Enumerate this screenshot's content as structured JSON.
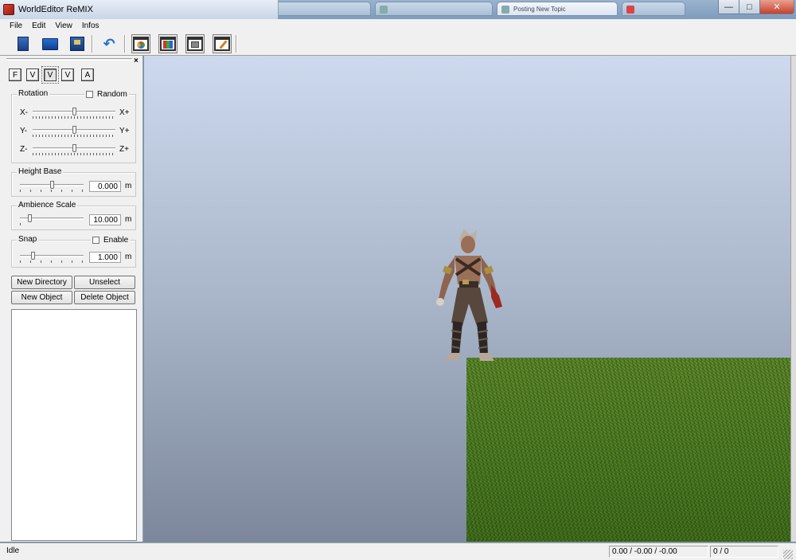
{
  "window": {
    "title": "WorldEditor ReMIX",
    "background_tabs": [
      {
        "label": "",
        "active": false
      },
      {
        "label": "",
        "active": false
      },
      {
        "label": "",
        "active": false
      },
      {
        "label": "",
        "active": false
      },
      {
        "label": "Posting New Topic",
        "active": true
      },
      {
        "label": "",
        "active": false
      }
    ]
  },
  "menu": {
    "items": [
      "File",
      "Edit",
      "View",
      "Infos"
    ]
  },
  "toolbar": {
    "buttons": [
      "new-document-icon",
      "open-folder-icon",
      "save-icon",
      "undo-icon",
      "world-window-icon",
      "palette-window-icon",
      "texture-window-icon",
      "paint-window-icon"
    ]
  },
  "panel": {
    "modes": [
      {
        "label": "F",
        "selected": false
      },
      {
        "label": "V",
        "selected": false
      },
      {
        "label": "V",
        "selected": true
      },
      {
        "label": "V",
        "selected": false
      },
      {
        "label": "A",
        "selected": false
      }
    ],
    "rotation": {
      "title": "Rotation",
      "random_label": "Random",
      "random_checked": false,
      "axes": [
        {
          "min": "X-",
          "max": "X+",
          "position": 0.5
        },
        {
          "min": "Y-",
          "max": "Y+",
          "position": 0.5
        },
        {
          "min": "Z-",
          "max": "Z+",
          "position": 0.5
        }
      ]
    },
    "height_base": {
      "title": "Height Base",
      "value": "0.000",
      "unit": "m",
      "position": 0.5
    },
    "ambience_scale": {
      "title": "Ambience Scale",
      "value": "10.000",
      "unit": "m",
      "position": 0.1
    },
    "snap": {
      "title": "Snap",
      "enable_label": "Enable",
      "enable_checked": false,
      "value": "1.000",
      "unit": "m",
      "position": 0.2
    },
    "buttons": {
      "new_directory": "New Directory",
      "unselect": "Unselect",
      "new_object": "New Object",
      "delete_object": "Delete Object"
    },
    "object_list": []
  },
  "status": {
    "state": "Idle",
    "coords": "0.00 / -0.00 / -0.00",
    "count": "0 / 0"
  }
}
